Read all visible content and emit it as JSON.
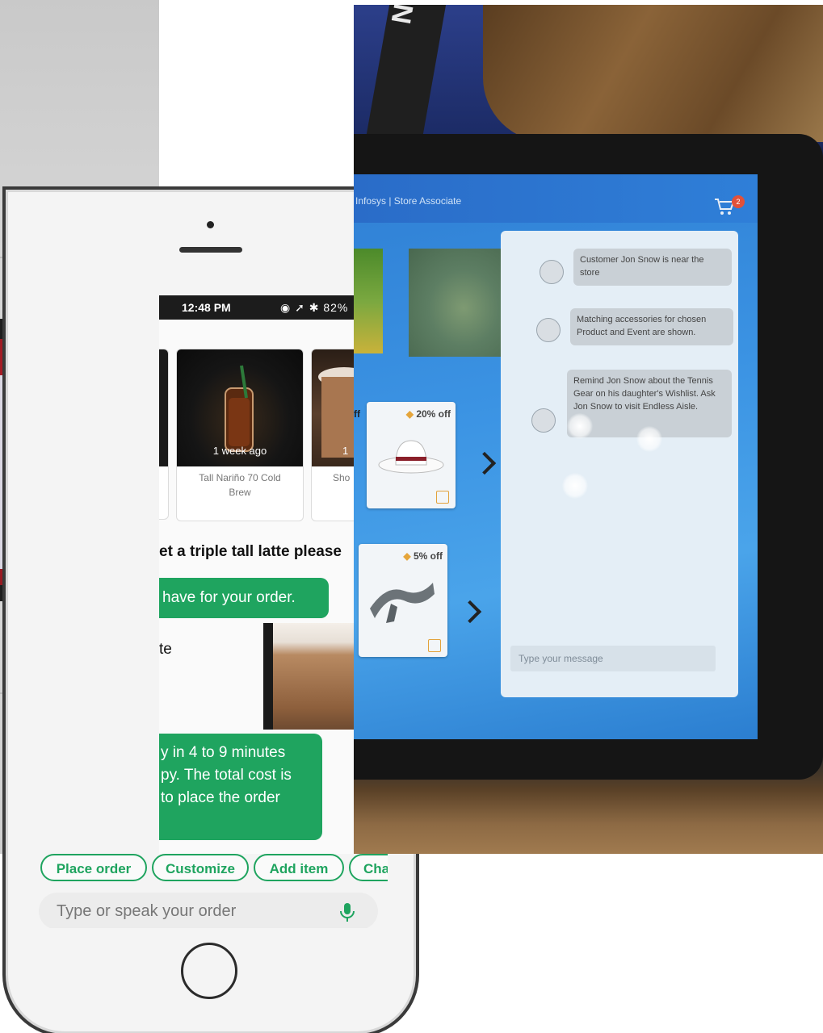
{
  "phone": {
    "status_time": "12:48 PM",
    "status_icons": "◉ ➚ ✱ 82%",
    "cards": [
      {
        "overlay": "",
        "caption": ""
      },
      {
        "overlay": "1 week ago",
        "caption": "Tall Nariño 70 Cold Brew"
      },
      {
        "overlay": "1",
        "caption": "Sho"
      }
    ],
    "user_message": "et a triple tall latte please",
    "bot_message_1": "have for your order.",
    "item_partial": "te",
    "bot_message_2": [
      "y in 4 to 9 minutes",
      "py. The total cost is",
      "to place the order"
    ],
    "actions": [
      "Place order",
      "Customize",
      "Add item",
      "Cha"
    ],
    "input_placeholder": "Type or speak your order",
    "colors": {
      "accent": "#1fa45f"
    }
  },
  "tablet": {
    "lanyard_text": "NRF",
    "app_title": "Infosys | Store Associate",
    "cart_badge": "2",
    "products": [
      {
        "discount": "20% off",
        "icon": "hat-icon"
      },
      {
        "discount": "5% off",
        "icon": "scarf-icon"
      }
    ],
    "chat_messages": [
      "Customer Jon Snow is near the store",
      "Matching accessories for chosen Product and Event are shown.",
      "Remind Jon Snow about the Tennis Gear on his daughter's Wishlist. Ask Jon Snow to visit Endless Aisle."
    ],
    "message_placeholder": "Type your message",
    "colors": {
      "header": "#2a6cc8",
      "badge": "#e2513a"
    }
  }
}
